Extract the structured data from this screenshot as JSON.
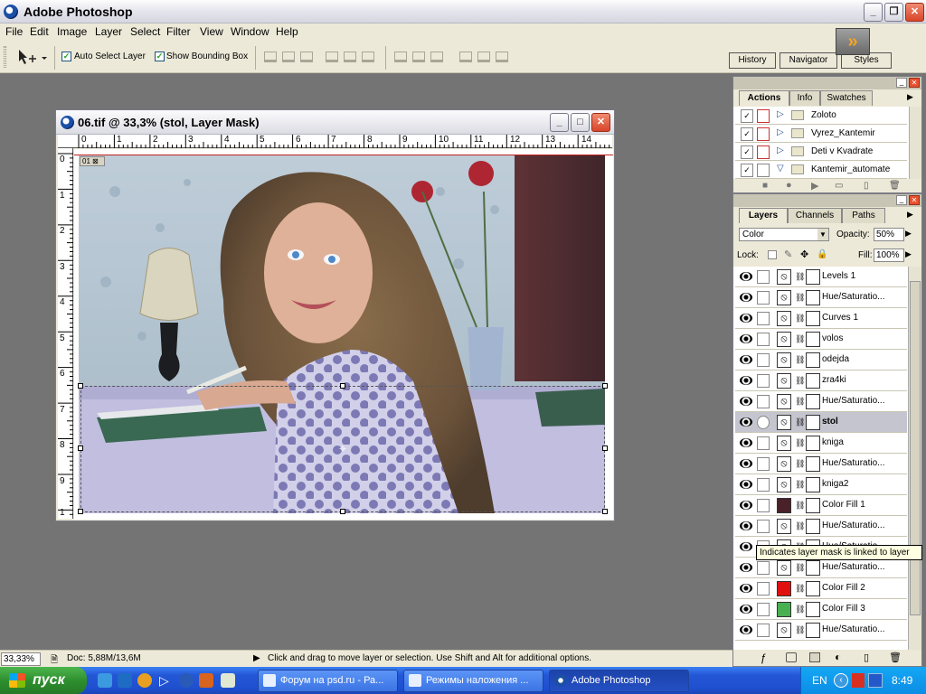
{
  "app": {
    "title": "Adobe Photoshop",
    "menu": [
      "File",
      "Edit",
      "Image",
      "Layer",
      "Select",
      "Filter",
      "View",
      "Window",
      "Help"
    ]
  },
  "options": {
    "auto_select_label": "Auto Select Layer",
    "auto_select_checked": true,
    "show_bbox_label": "Show Bounding Box",
    "show_bbox_checked": true
  },
  "palette_well": {
    "tabs": [
      "History",
      "Navigator",
      "Styles"
    ]
  },
  "document": {
    "title": "06.tif @ 33,3% (stol, Layer Mask)",
    "ruler_h": [
      "0",
      "1",
      "2",
      "3",
      "4",
      "5",
      "6",
      "7",
      "8",
      "9",
      "10",
      "11",
      "12",
      "13",
      "14"
    ],
    "ruler_v": [
      "0",
      "1",
      "2",
      "3",
      "4",
      "5",
      "6",
      "7",
      "8",
      "9",
      "1"
    ],
    "badge_text": "01"
  },
  "actions_panel": {
    "tabs": [
      "Actions",
      "Info",
      "Swatches"
    ],
    "items": [
      {
        "name": "Zoloto",
        "expanded": false
      },
      {
        "name": "Vyrez_Kantemir",
        "expanded": false
      },
      {
        "name": "Deti v Kvadrate",
        "expanded": false
      },
      {
        "name": "Kantemir_automate",
        "expanded": true
      }
    ]
  },
  "layers_panel": {
    "tabs": [
      "Layers",
      "Channels",
      "Paths"
    ],
    "blend_mode": "Color",
    "opacity_label": "Opacity:",
    "opacity": "50%",
    "lock_label": "Lock:",
    "fill_label": "Fill:",
    "fill": "100%",
    "layers": [
      {
        "name": "Levels 1",
        "type": "adjustment"
      },
      {
        "name": "Hue/Saturatio...",
        "type": "adjustment"
      },
      {
        "name": "Curves 1",
        "type": "adjustment"
      },
      {
        "name": "volos",
        "type": "adjustment"
      },
      {
        "name": "odejda",
        "type": "adjustment"
      },
      {
        "name": "zra4ki",
        "type": "adjustment"
      },
      {
        "name": "Hue/Saturatio...",
        "type": "adjustment"
      },
      {
        "name": "stol",
        "type": "adjustment",
        "selected": true
      },
      {
        "name": "kniga",
        "type": "adjustment"
      },
      {
        "name": "Hue/Saturatio...",
        "type": "adjustment"
      },
      {
        "name": "kniga2",
        "type": "adjustment"
      },
      {
        "name": "Color Fill 1",
        "type": "fill",
        "color": "#4a2128"
      },
      {
        "name": "Hue/Saturatio...",
        "type": "adjustment"
      },
      {
        "name": "Hue/Saturatio...",
        "type": "adjustment"
      },
      {
        "name": "Hue/Saturatio...",
        "type": "adjustment"
      },
      {
        "name": "Color Fill 2",
        "type": "fill",
        "color": "#e01010"
      },
      {
        "name": "Color Fill 3",
        "type": "fill",
        "color": "#48b050"
      },
      {
        "name": "Hue/Saturatio...",
        "type": "adjustment"
      }
    ],
    "tooltip": "Indicates layer mask is linked to layer"
  },
  "status": {
    "zoom": "33,33%",
    "doc": "Doc: 5,88M/13,6M",
    "hint": "Click and drag to move layer or selection.  Use Shift and Alt for additional options."
  },
  "taskbar": {
    "start_label": "пуск",
    "tasks": [
      {
        "label": "Форум на psd.ru - Ра..."
      },
      {
        "label": "Режимы наложения ..."
      },
      {
        "label": "Adobe Photoshop",
        "active": true
      }
    ],
    "lang": "EN",
    "clock": "8:49"
  }
}
